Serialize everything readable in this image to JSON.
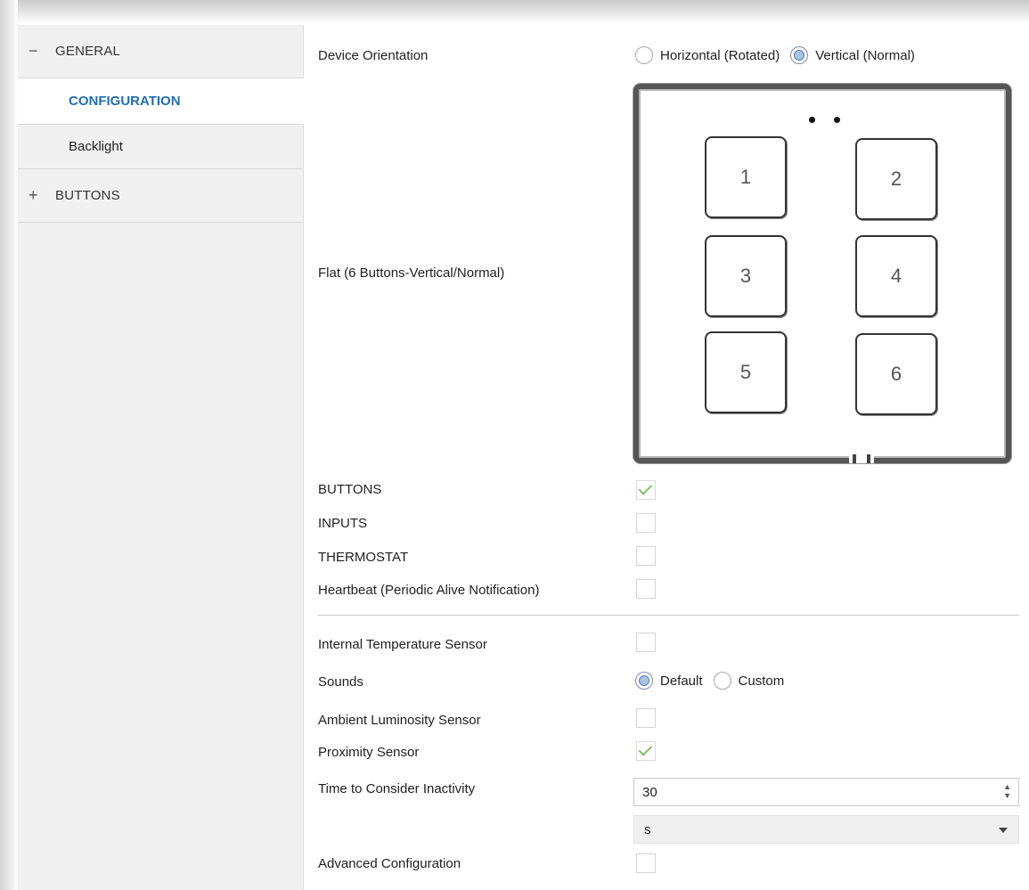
{
  "sidebar": {
    "groups": [
      {
        "toggle": "−",
        "label": "GENERAL",
        "items": [
          {
            "label": "CONFIGURATION",
            "selected": true
          },
          {
            "label": "Backlight",
            "selected": false
          }
        ]
      },
      {
        "toggle": "+",
        "label": "BUTTONS",
        "items": []
      }
    ]
  },
  "main": {
    "device_orientation": {
      "label": "Device Orientation",
      "options": [
        "Horizontal (Rotated)",
        "Vertical (Normal)"
      ],
      "selected": "Vertical (Normal)"
    },
    "device_preview": {
      "label": "Flat (6 Buttons-Vertical/Normal)",
      "buttons": [
        "1",
        "2",
        "3",
        "4",
        "5",
        "6"
      ]
    },
    "checkboxes_top": [
      {
        "label": "BUTTONS",
        "checked": true
      },
      {
        "label": "INPUTS",
        "checked": false
      },
      {
        "label": "THERMOSTAT",
        "checked": false
      },
      {
        "label": "Heartbeat (Periodic Alive Notification)",
        "checked": false
      }
    ],
    "internal_temperature_sensor": {
      "label": "Internal Temperature Sensor",
      "checked": false
    },
    "sounds": {
      "label": "Sounds",
      "options": [
        "Default",
        "Custom"
      ],
      "selected": "Default"
    },
    "ambient_luminosity_sensor": {
      "label": "Ambient Luminosity Sensor",
      "checked": false
    },
    "proximity_sensor": {
      "label": "Proximity Sensor",
      "checked": true
    },
    "time_to_consider_inactivity": {
      "label": "Time to Consider Inactivity",
      "value": "30",
      "unit": "s"
    },
    "advanced_configuration": {
      "label": "Advanced Configuration",
      "checked": false
    }
  },
  "colors": {
    "selected_item_text": "#1f6fb5",
    "sidebar_bg": "#f0f0f0",
    "check_green": "#7cbf6a",
    "radio_fill": "#a9c3e6"
  }
}
